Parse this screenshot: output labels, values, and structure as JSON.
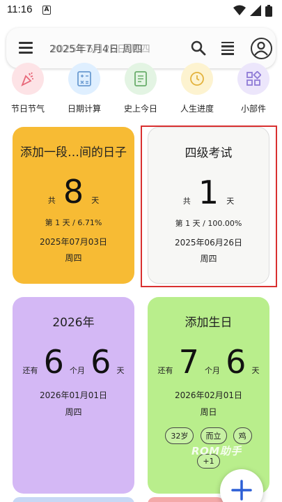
{
  "status": {
    "time": "11:16",
    "notif": "A"
  },
  "search": {
    "title": "2025年7月4日 周四",
    "title_ghost": "2025年6月26日 周四"
  },
  "shortcuts": [
    {
      "label": "节日节气",
      "icon": "party-popper-icon",
      "color": "#fde3e6",
      "fg": "#e8697a"
    },
    {
      "label": "日期计算",
      "icon": "calculator-icon",
      "color": "#dfefff",
      "fg": "#6b9bd1"
    },
    {
      "label": "史上今日",
      "icon": "notebook-icon",
      "color": "#e3f4e3",
      "fg": "#69ad6b"
    },
    {
      "label": "人生进度",
      "icon": "clock-icon",
      "color": "#fdf3d0",
      "fg": "#e3b23c"
    },
    {
      "label": "小部件",
      "icon": "widgets-icon",
      "color": "#ece6fb",
      "fg": "#8f7bd6"
    }
  ],
  "cards": {
    "c1": {
      "title": "添加一段…间的日子",
      "prefix": "共",
      "number": "8",
      "suffix": "天",
      "progress": "第 1 天 / 6.71%",
      "date": "2025年07月03日",
      "weekday": "周四",
      "color": "#f7bb34"
    },
    "c2": {
      "title": "四级考试",
      "prefix": "共",
      "number": "1",
      "suffix": "天",
      "progress": "第 1 天 / 100.00%",
      "date": "2025年06月26日",
      "weekday": "周四",
      "color": "#f7f7f5"
    },
    "c3": {
      "title": "2026年",
      "prefix": "还有",
      "number1": "6",
      "mid": "个月",
      "number2": "6",
      "suffix": "天",
      "date": "2026年01月01日",
      "weekday": "周四",
      "color": "#d4b8f5"
    },
    "c4": {
      "title": "添加生日",
      "prefix": "还有",
      "number1": "7",
      "mid": "个月",
      "number2": "6",
      "suffix": "天",
      "date": "2026年02月01日",
      "weekday": "周日",
      "tags": [
        "32岁",
        "而立",
        "鸡"
      ],
      "more": "+1",
      "color": "#b9ee8c"
    }
  },
  "watermark": "ROM助手"
}
